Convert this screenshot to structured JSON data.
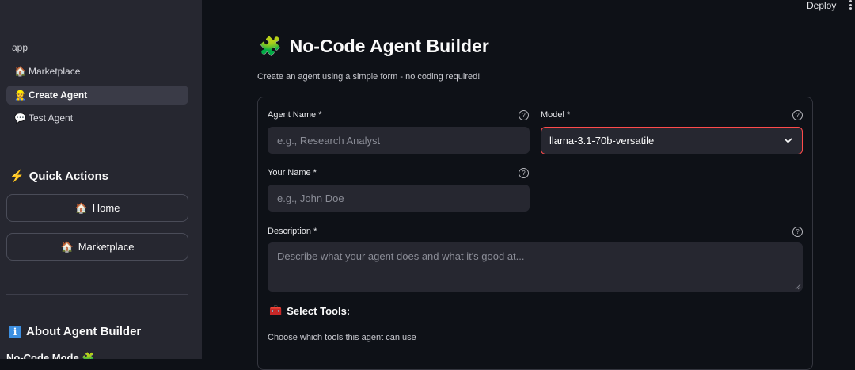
{
  "header": {
    "deploy_label": "Deploy"
  },
  "sidebar": {
    "app_label": "app",
    "nav": [
      {
        "icon": "🏠",
        "label": "Marketplace"
      },
      {
        "icon": "👷",
        "label": "Create Agent",
        "active": true
      },
      {
        "icon": "💬",
        "label": "Test Agent"
      }
    ],
    "quick_actions_icon": "⚡",
    "quick_actions_title": "Quick Actions",
    "buttons": [
      {
        "icon": "🏠",
        "label": "Home"
      },
      {
        "icon": "🏠",
        "label": "Marketplace"
      }
    ],
    "about_icon": "i",
    "about_title": "About Agent Builder",
    "no_code_mode": "No-Code Mode 🧩"
  },
  "main": {
    "title_icon": "🧩",
    "title": "No-Code Agent Builder",
    "subtitle": "Create an agent using a simple form - no coding required!",
    "form": {
      "agent_name_label": "Agent Name *",
      "agent_name_placeholder": "e.g., Research Analyst",
      "model_label": "Model *",
      "model_value": "llama-3.1-70b-versatile",
      "your_name_label": "Your Name *",
      "your_name_placeholder": "e.g., John Doe",
      "description_label": "Description *",
      "description_placeholder": "Describe what your agent does and what it's good at...",
      "help_glyph": "?"
    },
    "tools_icon": "🧰",
    "tools_title": "Select Tools:",
    "tools_subtitle": "Choose which tools this agent can use"
  },
  "colors": {
    "accent": "#ff4b4b",
    "sidebar_bg": "#262730",
    "main_bg": "#0e1117"
  }
}
